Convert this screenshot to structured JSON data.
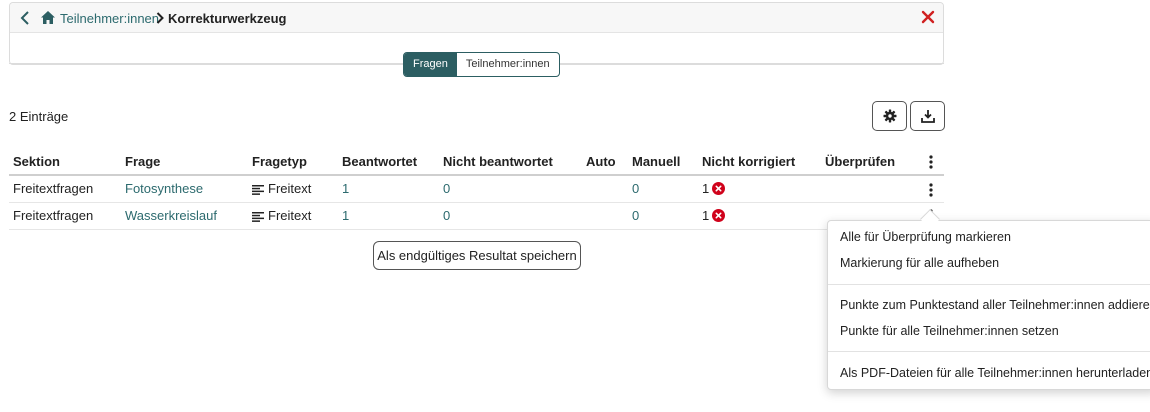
{
  "breadcrumb": {
    "parent_label": "Teilnehmer:innen",
    "current_label": "Korrekturwerkzeug"
  },
  "segments": {
    "questions_label": "Fragen",
    "participants_label": "Teilnehmer:innen",
    "active": "Fragen"
  },
  "entries_count": "2 Einträge",
  "table": {
    "columns": [
      "Sektion",
      "Frage",
      "Fragetyp",
      "Beantwortet",
      "Nicht beantwortet",
      "Auto",
      "Manuell",
      "Nicht korrigiert",
      "Überprüfen"
    ],
    "rows": [
      {
        "section": "Freitextfragen",
        "question": "Fotosynthese",
        "type": "Freitext",
        "answered": "1",
        "not_answered": "0",
        "auto": "",
        "manual": "0",
        "not_corrected": "1",
        "review": ""
      },
      {
        "section": "Freitextfragen",
        "question": "Wasserkreislauf",
        "type": "Freitext",
        "answered": "1",
        "not_answered": "0",
        "auto": "",
        "manual": "0",
        "not_corrected": "1",
        "review": ""
      }
    ]
  },
  "save_button_label": "Als endgültiges Resultat speichern",
  "menu": {
    "items": [
      "Alle für Überprüfung markieren",
      "Markierung für alle aufheben",
      "Punkte zum Punktestand aller Teilnehmer:innen addieren",
      "Punkte für alle Teilnehmer:innen setzen",
      "Als PDF-Dateien für alle Teilnehmer:innen herunterladen"
    ]
  },
  "colors": {
    "accent": "#2c5e62",
    "link": "#2c6a6e",
    "error": "#d0021b",
    "close": "#d02020"
  },
  "icons": [
    "chevron-left-icon",
    "home-icon",
    "chevron-right-icon",
    "close-icon",
    "gear-icon",
    "download-icon",
    "kebab-icon",
    "text-lines-icon",
    "error-circle-icon"
  ]
}
